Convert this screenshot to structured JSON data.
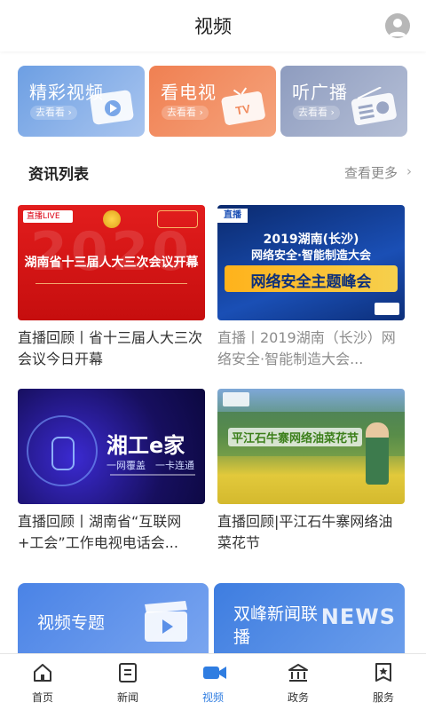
{
  "header": {
    "title": "视频"
  },
  "categories": [
    {
      "title": "精彩视频",
      "go": "去看看 ›"
    },
    {
      "title": "看电视",
      "go": "去看看 ›",
      "icon_text": "TV"
    },
    {
      "title": "听广播",
      "go": "去看看 ›"
    }
  ],
  "section": {
    "title": "资讯列表",
    "more": "查看更多"
  },
  "videos": [
    {
      "title": "直播回顾丨省十三届人大三次会议今日开幕",
      "thumb": {
        "badge": "直播LIVE",
        "headline": "湖南省十三届人大三次会议开幕",
        "bg_text": "2020"
      }
    },
    {
      "title": "直播丨2019湖南（长沙）网络安全·智能制造大会...",
      "thumb": {
        "badge": "直播",
        "line1": "2019湖南(长沙)",
        "line2": "网络安全·智能制造大会",
        "banner": "网络安全主题峰会"
      }
    },
    {
      "title": "直播回顾丨湖南省“互联网+工会”工作电视电话会...",
      "thumb": {
        "brand": "湘工e家",
        "slogan": "一网覆盖　一卡连通"
      }
    },
    {
      "title": "直播回顾|平江石牛寨网络油菜花节",
      "thumb": {
        "headline": "平江石牛寨网络油菜花节"
      }
    }
  ],
  "promos": [
    {
      "title": "视频专题"
    },
    {
      "title": "双峰新闻联播",
      "art": "NEWS"
    }
  ],
  "tabs": [
    {
      "label": "首页",
      "icon": "home-icon",
      "active": false
    },
    {
      "label": "新闻",
      "icon": "news-icon",
      "active": false
    },
    {
      "label": "视频",
      "icon": "video-icon",
      "active": true
    },
    {
      "label": "政务",
      "icon": "government-icon",
      "active": false
    },
    {
      "label": "服务",
      "icon": "service-icon",
      "active": false
    }
  ],
  "colors": {
    "accent": "#2f7de1",
    "cat1": "#6d9fe3",
    "cat2": "#f08052",
    "cat3": "#8e9cbf"
  }
}
